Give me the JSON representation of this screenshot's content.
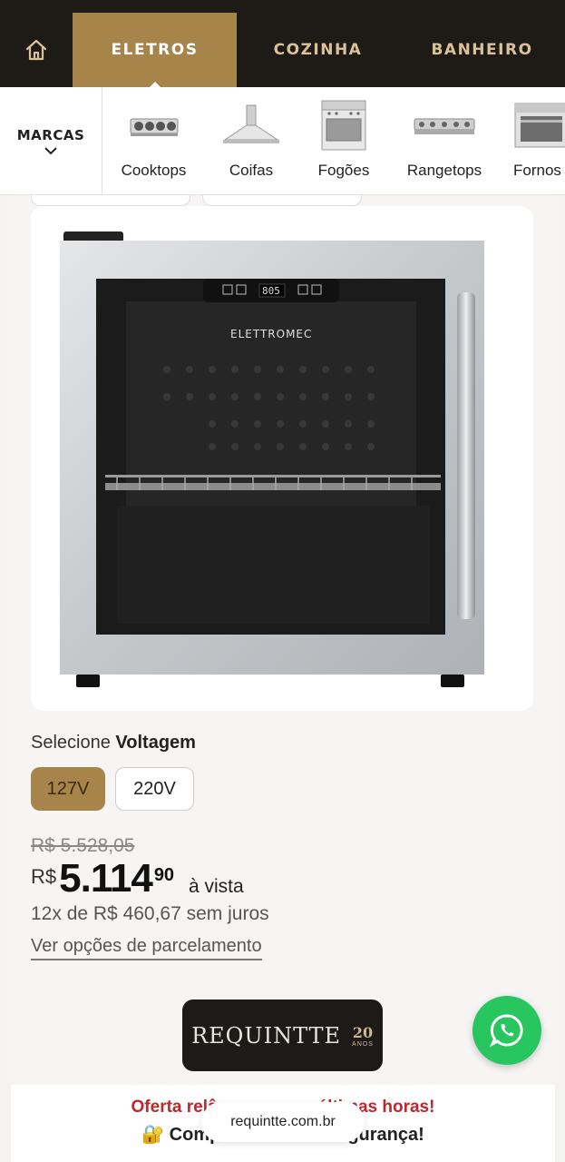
{
  "nav": {
    "home_icon": "home-icon",
    "tabs": [
      {
        "label": "ELETROS",
        "active": true
      },
      {
        "label": "COZINHA",
        "active": false
      },
      {
        "label": "BANHEIRO",
        "active": false
      }
    ],
    "accent_color": "#a6844a",
    "bg_color": "#1e1a16"
  },
  "categories": {
    "brands_label": "MARCAS",
    "items": [
      {
        "label": "Cooktops",
        "icon": "cooktop-icon"
      },
      {
        "label": "Coifas",
        "icon": "range-hood-icon"
      },
      {
        "label": "Fogões",
        "icon": "stove-icon"
      },
      {
        "label": "Rangetops",
        "icon": "rangetop-icon"
      },
      {
        "label": "Fornos",
        "icon": "oven-icon"
      }
    ]
  },
  "product": {
    "image_brand": "ELETTROMEC",
    "display_readout": "805",
    "voltage": {
      "prefix": "Selecione",
      "label": "Voltagem",
      "options": [
        "127V",
        "220V"
      ],
      "selected": "127V"
    },
    "old_price": "R$ 5.528,05",
    "price": {
      "currency": "R$",
      "integer": "5.114",
      "cents": "90",
      "suffix": "à vista"
    },
    "installments": "12x de R$ 460,67 sem juros",
    "installments_link": "Ver opções de parcelamento"
  },
  "store_logo": {
    "name": "REQUINTTE",
    "years": "20",
    "years_label": "ANOS"
  },
  "banner": {
    "offer_text": "Oferta relâ... últimas horas!",
    "offer_left": "Oferta relâ",
    "offer_right": "últimas horas!",
    "secure_left": "Comp",
    "secure_right": "gurança!",
    "lock_icon": "lock-icon"
  },
  "url_pill": "requintte.com.br",
  "whatsapp": {
    "icon": "whatsapp-icon",
    "color": "#27c65f"
  }
}
